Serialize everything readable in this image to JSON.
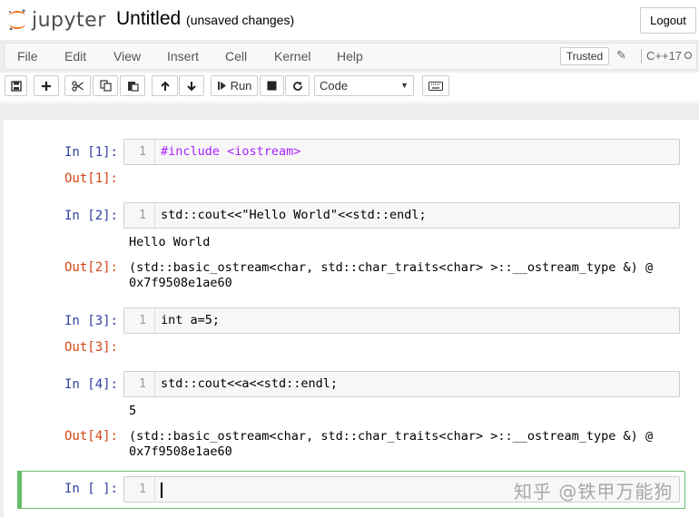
{
  "header": {
    "logo_text": "jupyter",
    "notebook_name": "Untitled",
    "save_status": "(unsaved changes)",
    "logout_label": "Logout"
  },
  "menubar": {
    "items": [
      "File",
      "Edit",
      "View",
      "Insert",
      "Cell",
      "Kernel",
      "Help"
    ],
    "trusted_label": "Trusted",
    "kernel_name": "C++17"
  },
  "toolbar": {
    "run_label": "Run",
    "cell_type": "Code"
  },
  "cells": [
    {
      "prompt_in": "In [1]:",
      "line": "1",
      "code": "#include <iostream>",
      "prompt_out": "Out[1]:"
    },
    {
      "prompt_in": "In [2]:",
      "line": "1",
      "code": "std::cout<<\"Hello World\"<<std::endl;",
      "stdout": "Hello World",
      "prompt_out": "Out[2]:",
      "result": "(std::basic_ostream<char, std::char_traits<char> >::__ostream_type &) @\n0x7f9508e1ae60"
    },
    {
      "prompt_in": "In [3]:",
      "line": "1",
      "code": "int a=5;",
      "prompt_out": "Out[3]:"
    },
    {
      "prompt_in": "In [4]:",
      "line": "1",
      "code": "std::cout<<a<<std::endl;",
      "stdout": "5",
      "prompt_out": "Out[4]:",
      "result": "(std::basic_ostream<char, std::char_traits<char> >::__ostream_type &) @\n0x7f9508e1ae60"
    },
    {
      "prompt_in": "In [ ]:",
      "line": "1",
      "code": ""
    }
  ],
  "watermark": "知乎 @铁甲万能狗",
  "colors": {
    "prompt_in": "#303f9f",
    "prompt_out": "#d84315",
    "selected_cell": "#66bb6a",
    "preprocessor": "#aa22ff",
    "logo_orange": "#f37726"
  }
}
